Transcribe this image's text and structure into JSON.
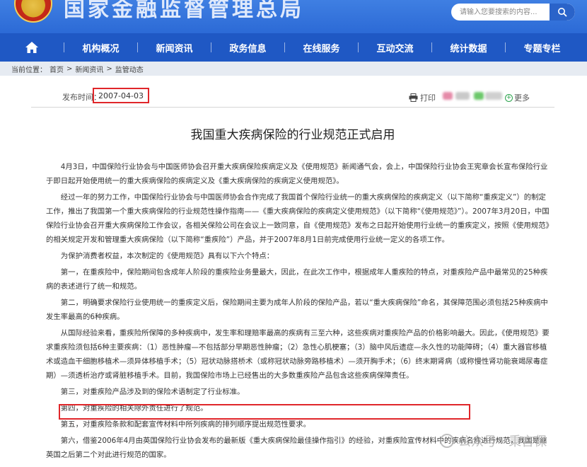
{
  "header": {
    "site_title": "国家金融监督管理总局",
    "search_placeholder": "请输入您要搜索的内容..."
  },
  "nav": {
    "items": [
      "机构概况",
      "新闻资讯",
      "政务信息",
      "在线服务",
      "互动交流",
      "统计数据",
      "专题专栏"
    ]
  },
  "breadcrumb": {
    "prefix": "当前位置：",
    "items": [
      "首页",
      "新闻资讯",
      "监管动态"
    ],
    "separator": ">"
  },
  "article": {
    "pub_label": "发布时间：",
    "pub_date": "2007-04-03",
    "print_label": "打印",
    "more_label": "更多",
    "title": "我国重大疾病保险的行业规范正式启用",
    "paragraphs": [
      "4月3日，中国保险行业协会与中国医师协会召开重大疾病保险疾病定义及《使用规范》新闻通气会，会上，中国保险行业协会王宪章会长宣布保险行业于即日起开始使用统一的重大疾病保险的疾病定义及《重大疾病保险的疾病定义使用规范》。",
      "经过一年的努力工作，中国保险行业协会与中国医师协会合作完成了我国首个保险行业统一的重大疾病保险的疾病定义（以下简称“重疾定义”）的制定工作，推出了我国第一个重大疾病保险的行业规范性操作指南——《重大疾病保险的疾病定义使用规范》（以下简称“《使用规范》”）。2007年3月20日，中国保险行业协会召开重大疾病保险工作会议，各相关保险公司在会议上一致同意，自《使用规范》发布之日起开始使用行业统一的重疾定义，按照《使用规范》的相关规定开发和管理重大疾病保险（以下简称“重疾险”）产品，并于2007年8月1日前完成使用行业统一定义的各项工作。",
      "为保护消费者权益，本次制定的《使用规范》具有以下六个特点：",
      "第一，在重疾险中，保险期间包含成年人阶段的重疾险业务量最大，因此，在此次工作中，根据成年人重疾险的特点，对重疾险产品中最常见的25种疾病的表述进行了统一和规范。",
      "第二，明确要求保险行业使用统一的重疾定义后，保险期间主要为成年人阶段的保险产品，若以“重大疾病保险”命名，其保障范围必须包括25种疾病中发生率最高的6种疾病。",
      "从国际经验来看，重疾险所保障的多种疾病中，发生率和理赔率最高的疾病有三至六种，这些疾病对重疾险产品的价格影响最大。因此，《使用规范》要求重疾险须包括6种主要疾病：（1）恶性肿瘤—不包括部分早期恶性肿瘤；（2）急性心肌梗塞；（3）脑中风后遗症—永久性的功能障碍；（4）重大器官移植术或造血干细胞移植术—须异体移植手术；（5）冠状动脉搭桥术（或称冠状动脉旁路移植术）—须开胸手术；（6）终末期肾病（或称慢性肾功能衰竭尿毒症期）—须透析治疗或肾脏移植手术。目前，我国保险市场上已经售出的大多数重疾险产品包含这些疾病保障责任。",
      "第三，对重疾险产品涉及到的保险术语制定了行业标准。",
      "第四，对重疾险的相关除外责任进行了规范。",
      "第五，对重疾险条款和配套宣传材料中所列疾病的排列顺序提出规范性要求。",
      "第六，借鉴2006年4月由英国保险行业协会发布的最新版《重大疾病保险最佳操作指引》的经验，对重疾险宣传材料中的疾病名称进行规范，我国是继英国之后第二个对此进行规范的国家。"
    ]
  },
  "watermark": {
    "text": "公众号 · 秉言保"
  },
  "colors": {
    "header_blue": "#2c6ad6",
    "nav_blue": "#1f58c4",
    "highlight_red": "#e0262a"
  },
  "icons": {
    "home": "home-icon",
    "search": "search-icon",
    "print": "printer-icon",
    "more": "plus-circle-icon"
  }
}
